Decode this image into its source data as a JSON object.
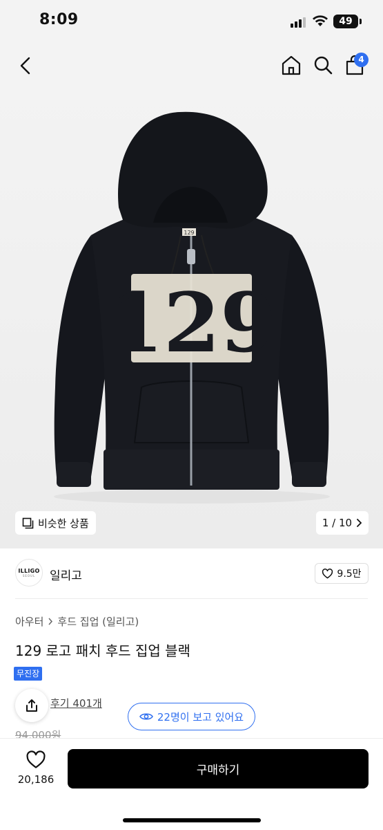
{
  "status_bar": {
    "time": "8:09",
    "battery": "49"
  },
  "nav": {
    "cart_count": "4"
  },
  "image": {
    "similar_label": "비슷한 상품",
    "counter": "1 / 10",
    "patch_text": "129",
    "label_text": "129"
  },
  "brand": {
    "logo_text": "ILLIGO",
    "logo_sub": "SEOUL",
    "name": "일리고",
    "likes": "9.5만"
  },
  "product": {
    "breadcrumb": [
      "아우터",
      "후드 집업 (일리고)"
    ],
    "title": "129 로고 패치 후드 집업 블랙",
    "tag": "무진장",
    "review_link": "후기 401개",
    "viewers": "22명이 보고 있어요",
    "original_price": "94,000원"
  },
  "bottom": {
    "wish_count": "20,186",
    "buy_label": "구매하기"
  },
  "colors": {
    "accent": "#2f6ff0",
    "buy_button": "#000000"
  }
}
